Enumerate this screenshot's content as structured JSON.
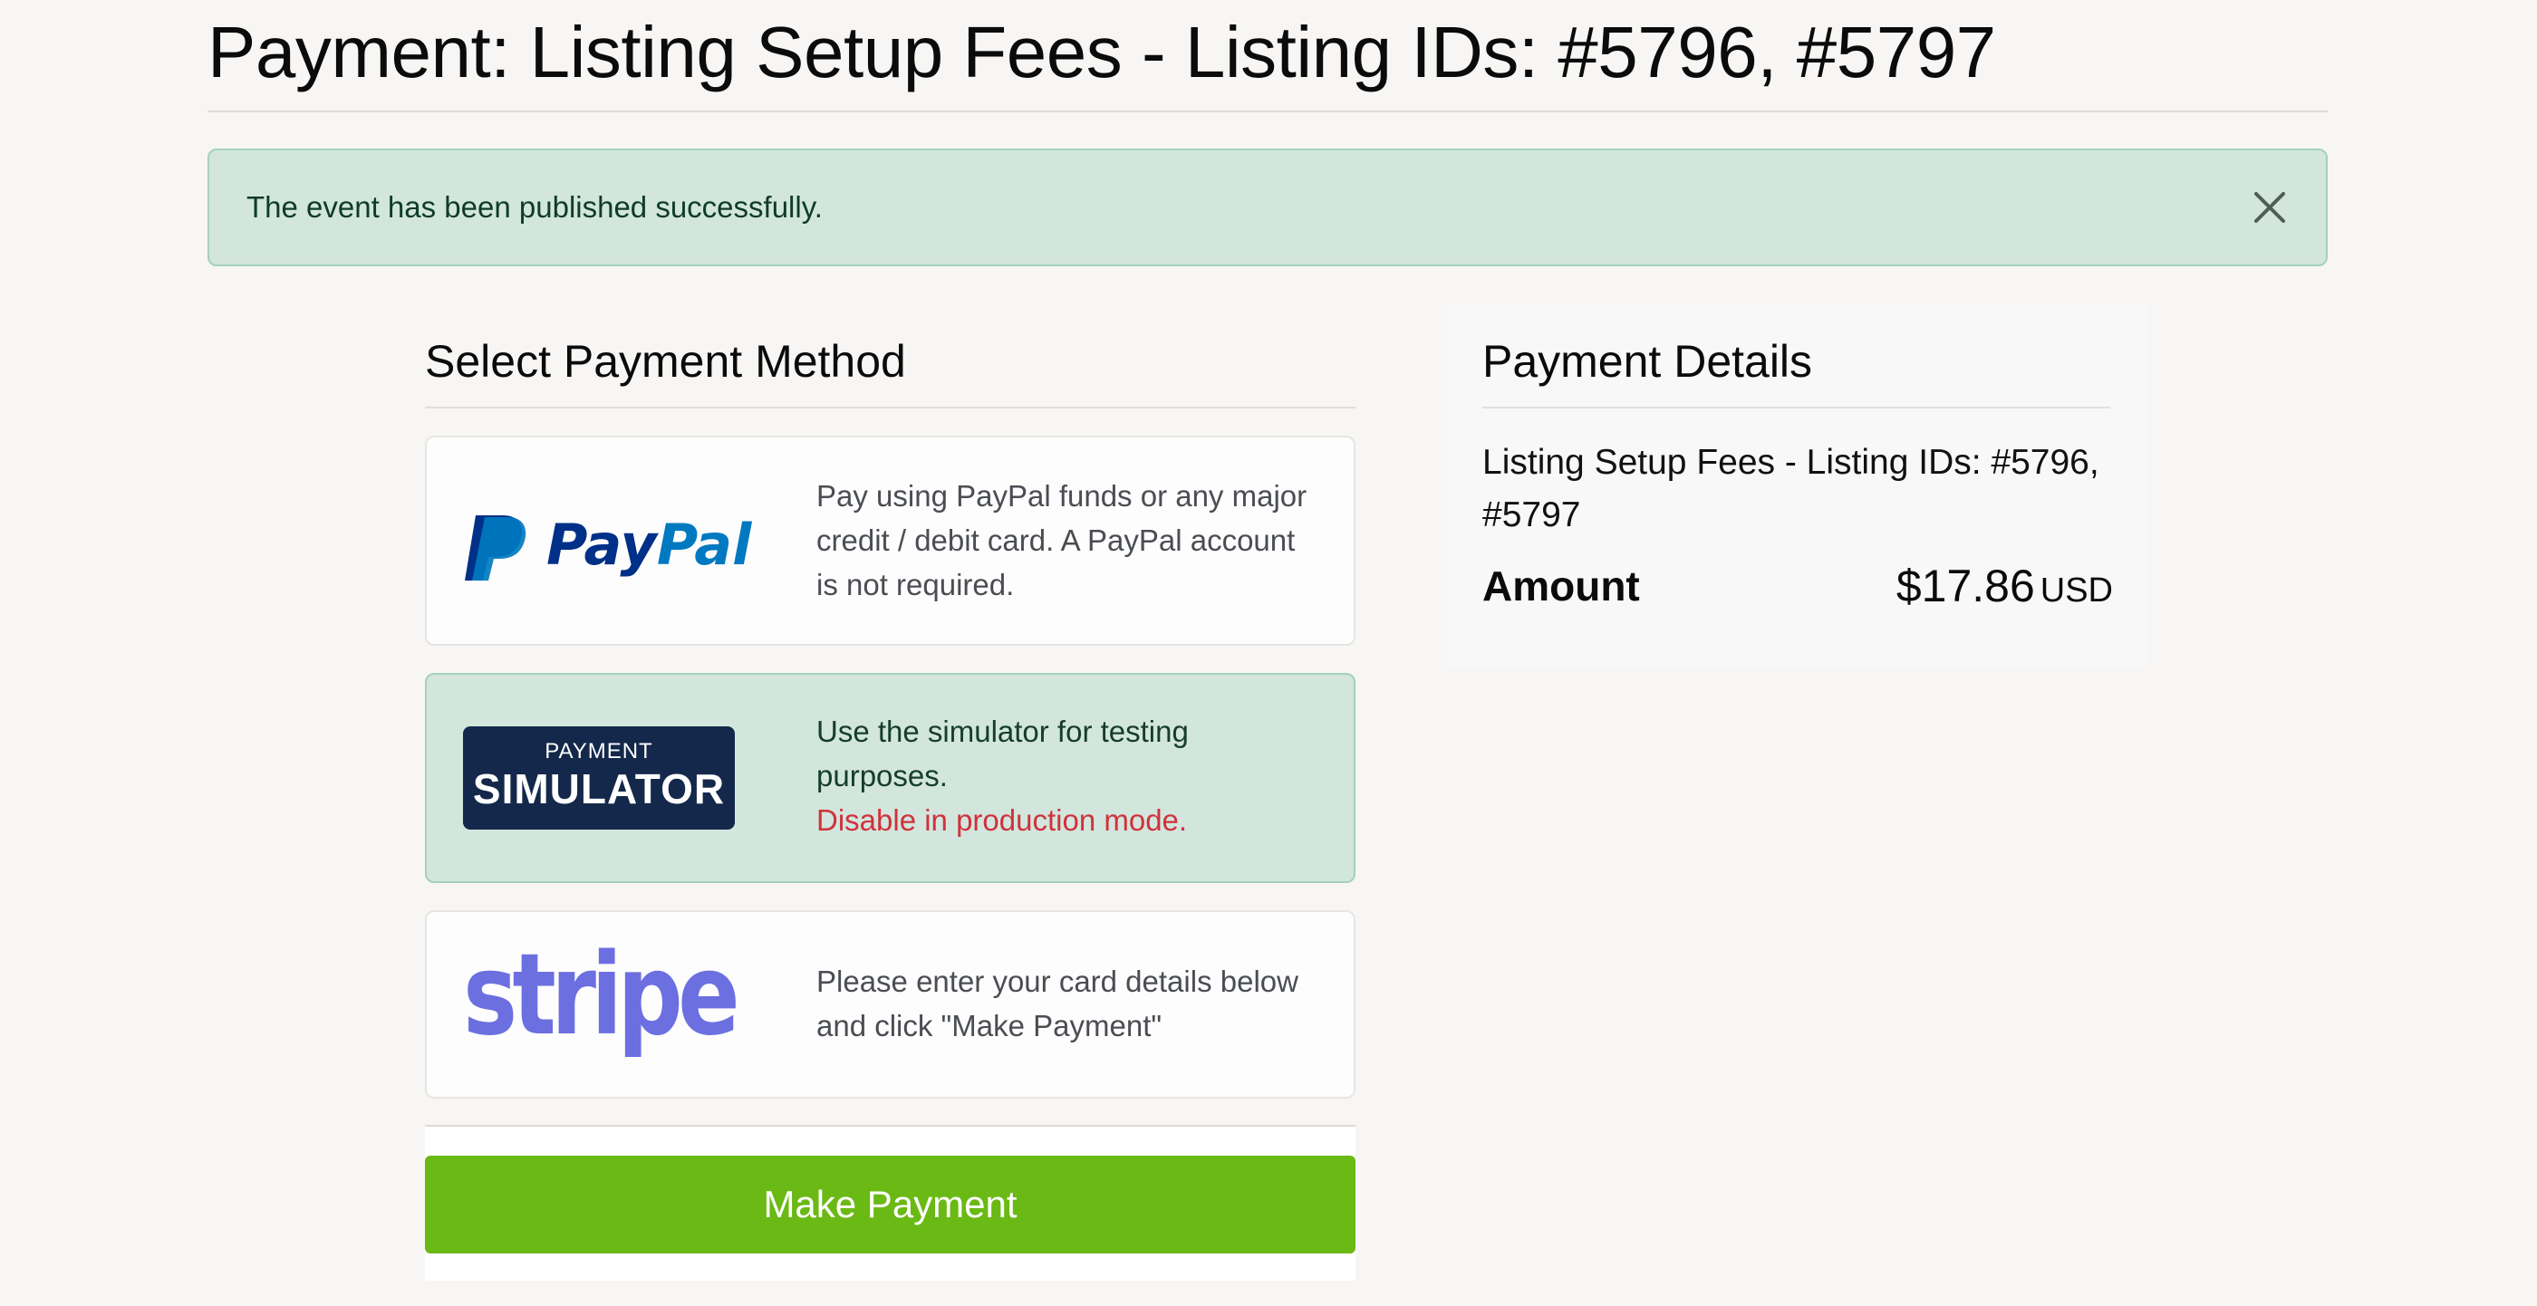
{
  "page": {
    "title": "Payment: Listing Setup Fees - Listing IDs: #5796, #5797"
  },
  "alert": {
    "message": "The event has been published successfully.",
    "close_icon": "close-icon",
    "background": "#d2e6dd"
  },
  "payment_methods": {
    "heading": "Select Payment Method",
    "options": [
      {
        "id": "paypal",
        "logo_text": "PayPal",
        "description": "Pay using PayPal funds or any major credit / debit card. A PayPal account is not required.",
        "selected": false
      },
      {
        "id": "simulator",
        "logo_small": "PAYMENT",
        "logo_big": "SIMULATOR",
        "description": "Use the simulator for testing purposes.",
        "warning": "Disable in production mode.",
        "selected": true
      },
      {
        "id": "stripe",
        "logo_text": "stripe",
        "description": "Please enter your card details below and click \"Make Payment\"",
        "selected": false
      }
    ],
    "submit_label": "Make Payment"
  },
  "payment_details": {
    "heading": "Payment Details",
    "description": "Listing Setup Fees - Listing IDs: #5796, #5797",
    "amount_label": "Amount",
    "amount_value": "$17.86",
    "currency": "USD"
  },
  "colors": {
    "success_bg": "#d2e6dd",
    "success_border": "#a6d0bd",
    "button_green": "#6ab914",
    "paypal_dark": "#003087",
    "paypal_light": "#0079c1",
    "stripe_purple": "#6c6fe0",
    "simulator_navy": "#13284a",
    "warning_red": "#d0323c"
  }
}
